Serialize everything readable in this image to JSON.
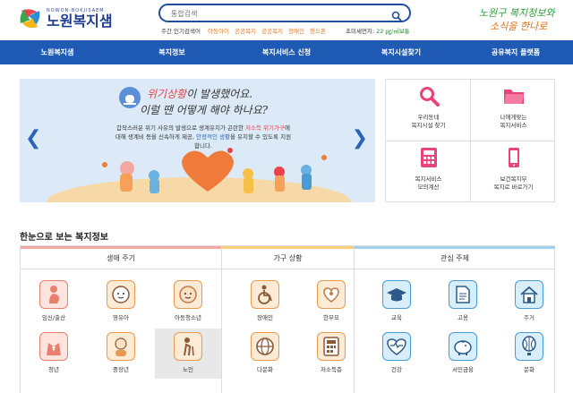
{
  "header": {
    "logo_sub": "NOWON-BOKJISAEM",
    "logo_main": "노원복지샘",
    "search_placeholder": "통합검색",
    "popular_label": "주간 인기검색어",
    "popular_terms": [
      "아동아이",
      "공공복지",
      "공공복지",
      "장애인",
      "핸드폰"
    ],
    "dust_label": "초미세먼지:",
    "dust_value": "22 ㎍/㎥보통",
    "slogan_line1": "노원구 복지정보와",
    "slogan_line2": "소식을 한나로"
  },
  "nav": {
    "items": [
      "노원복지샘",
      "복지정보",
      "복지서비스 신청",
      "복지시설찾기",
      "공유복지 플랫폼"
    ]
  },
  "banner": {
    "headline_em": "위기상황",
    "headline_rest": "이 발생했어요.",
    "headline2": "이럴 땐 어떻게 해야 하나요?",
    "desc_1": "갑작스러운 위기 사유의 발생으로 생계유지가 곤란한 ",
    "desc_red": "저소득",
    "desc_blue1": "위기가구",
    "desc_2": "에 대해 생계비 등을 신속하게 제공, ",
    "desc_blue2": "안정적인 생활",
    "desc_3": "을 유지할 수 있도록 지원합니다."
  },
  "quick": {
    "items": [
      {
        "line1": "우리동네",
        "line2": "복지시설 찾기",
        "icon": "search-icon"
      },
      {
        "line1": "나에게맞는",
        "line2": "복지서비스",
        "icon": "folder-icon"
      },
      {
        "line1": "복지서비스",
        "line2": "모의계산",
        "icon": "calculator-icon"
      },
      {
        "line1": "보건복지부",
        "line2": "복지로 바로가기",
        "icon": "phone-icon"
      }
    ],
    "colors": {
      "pink": "#e8437a"
    }
  },
  "section": {
    "title": "한눈으로 보는 복지정보",
    "cat_life": "생애 주기",
    "cat_household": "가구 상황",
    "cat_theme": "관심 주제",
    "life_items": [
      "임신/출산",
      "영유아",
      "아동청소년",
      "청년",
      "중장년",
      "노인"
    ],
    "household_items": [
      "장애인",
      "한부모",
      "다문화",
      "저소득층"
    ],
    "theme_items": [
      "교육",
      "고용",
      "주거",
      "건강",
      "서민금융",
      "문화"
    ]
  }
}
